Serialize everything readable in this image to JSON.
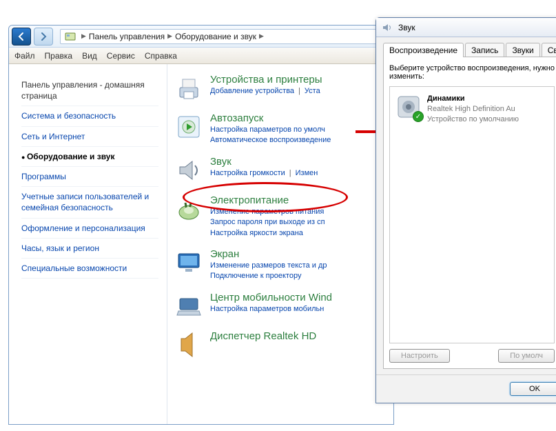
{
  "cp": {
    "breadcrumb": {
      "root": "Панель управления",
      "sub": "Оборудование и звук"
    },
    "menu": {
      "file": "Файл",
      "edit": "Правка",
      "view": "Вид",
      "tools": "Сервис",
      "help": "Справка"
    },
    "sidebar": {
      "home": "Панель управления - домашняя страница",
      "items": [
        "Система и безопасность",
        "Сеть и Интернет",
        "Оборудование и звук",
        "Программы",
        "Учетные записи пользователей и семейная безопасность",
        "Оформление и персонализация",
        "Часы, язык и регион",
        "Специальные возможности"
      ]
    },
    "cats": [
      {
        "title": "Устройства и принтеры",
        "links": [
          "Добавление устройства",
          "Уста"
        ]
      },
      {
        "title": "Автозапуск",
        "links": [
          "Настройка параметров по умолч",
          "Автоматическое воспроизведение"
        ]
      },
      {
        "title": "Звук",
        "links": [
          "Настройка громкости",
          "Измен"
        ]
      },
      {
        "title": "Электропитание",
        "links": [
          "Изменение параметров питания",
          "Запрос пароля при выходе из сп",
          "Настройка яркости экрана"
        ]
      },
      {
        "title": "Экран",
        "links": [
          "Изменение размеров текста и др",
          "Подключение к проектору"
        ]
      },
      {
        "title": "Центр мобильности Wind",
        "links": [
          "Настройка параметров мобильн"
        ]
      },
      {
        "title": "Диспетчер Realtek HD",
        "links": []
      }
    ]
  },
  "snd": {
    "title": "Звук",
    "tabs": [
      "Воспроизведение",
      "Запись",
      "Звуки",
      "Свя"
    ],
    "instr": "Выберите устройство воспроизведения, нужно изменить:",
    "dev": {
      "name": "Динамики",
      "make": "Realtek High Definition Au",
      "status": "Устройство по умолчанию"
    },
    "btns": {
      "configure": "Настроить",
      "default": "По умолч",
      "ok": "OK"
    }
  }
}
